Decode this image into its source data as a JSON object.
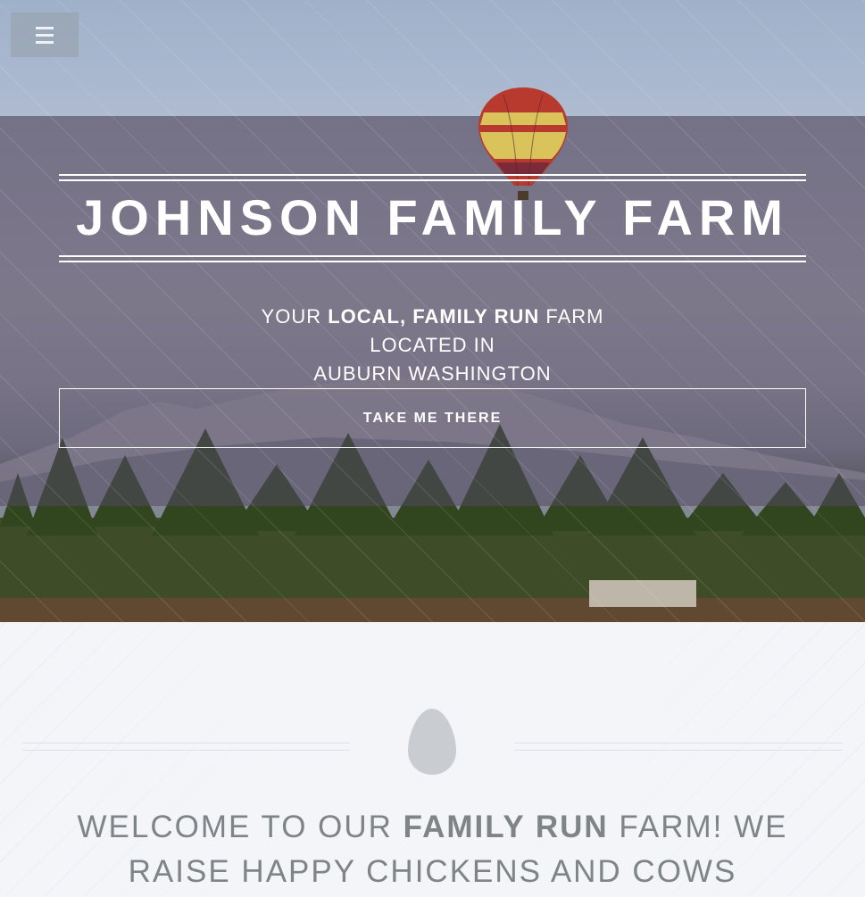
{
  "header": {
    "menu_icon": "hamburger-menu-icon"
  },
  "hero": {
    "title": "JOHNSON FAMILY FARM",
    "tagline": {
      "line1_pre": "YOUR ",
      "line1_bold": "LOCAL, FAMILY RUN",
      "line1_post": " FARM",
      "line2": "LOCATED IN",
      "line3": "AUBURN WASHINGTON"
    },
    "cta_label": "TAKE ME THERE",
    "background_image": "hot-air-balloon-over-mountain-and-trees"
  },
  "welcome": {
    "icon": "egg-icon",
    "text_pre": "WELCOME TO OUR ",
    "text_bold": "FAMILY RUN",
    "text_post": " FARM! WE RAISE HAPPY CHICKENS AND COWS"
  },
  "colors": {
    "hero_overlay": "#50465a",
    "text_light": "#ffffff",
    "section_bg": "#f3f5f9",
    "welcome_text": "#7f8487",
    "egg": "#c9ccd0"
  }
}
